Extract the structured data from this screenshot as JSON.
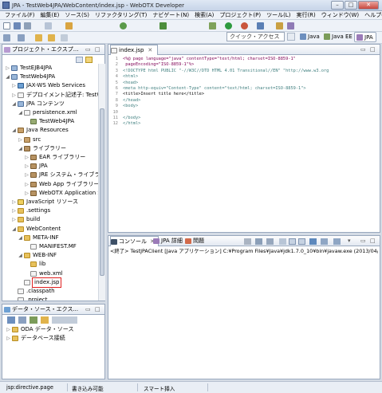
{
  "window": {
    "title": "JPA - TestWeb4JPA/WebContent/index.jsp - WebOTX Developer",
    "min": "–",
    "max": "□",
    "close": "✕"
  },
  "menu": [
    "ファイル(F)",
    "編集(E)",
    "ソース(S)",
    "リファクタリング(T)",
    "ナビゲート(N)",
    "検索(A)",
    "プロジェクト(P)",
    "ツール(L)",
    "実行(R)",
    "ウィンドウ(W)",
    "ヘルプ(H)"
  ],
  "toolbar": {
    "quick_access_placeholder": "クイック・アクセス",
    "perspectives": [
      {
        "label": "Java",
        "color": "#6d8fbe"
      },
      {
        "label": "Java EE",
        "color": "#7b9c5a"
      },
      {
        "label": "JPA",
        "color": "#9b7bb8"
      }
    ]
  },
  "project_explorer": {
    "title": "プロジェクト・エクスプ...",
    "items": [
      {
        "label": "TestEJB4JPA",
        "icon": "project-icon",
        "depth": 0,
        "tw": "▷"
      },
      {
        "label": "TestWeb4JPA",
        "icon": "project-icon",
        "depth": 0,
        "tw": "◢"
      },
      {
        "label": "JAX-WS Web Services",
        "icon": "webservice-icon",
        "depth": 1,
        "tw": "▷"
      },
      {
        "label": "デプロイメント記述子: TestW",
        "icon": "descriptor-icon",
        "depth": 1,
        "tw": "▷"
      },
      {
        "label": "JPA コンテンツ",
        "icon": "jpa-icon",
        "depth": 1,
        "tw": "◢"
      },
      {
        "label": "persistence.xml",
        "icon": "xml-file-icon",
        "depth": 2,
        "tw": "◢"
      },
      {
        "label": "TestWeb4JPA",
        "icon": "persistence-unit-icon",
        "depth": 3,
        "tw": ""
      },
      {
        "label": "Java Resources",
        "icon": "java-resources-icon",
        "depth": 1,
        "tw": "◢"
      },
      {
        "label": "src",
        "icon": "source-folder-icon",
        "depth": 2,
        "tw": "▷"
      },
      {
        "label": "ライブラリー",
        "icon": "library-icon",
        "depth": 2,
        "tw": "◢"
      },
      {
        "label": "EAR ライブラリー",
        "icon": "library-icon",
        "depth": 3,
        "tw": "▷"
      },
      {
        "label": "JPA",
        "icon": "library-icon",
        "depth": 3,
        "tw": "▷"
      },
      {
        "label": "JRE システム・ライブラ",
        "icon": "library-icon",
        "depth": 3,
        "tw": "▷"
      },
      {
        "label": "Web App ライブラリー",
        "icon": "library-icon",
        "depth": 3,
        "tw": "▷"
      },
      {
        "label": "WebOTX Application S",
        "icon": "library-icon",
        "depth": 3,
        "tw": "▷"
      },
      {
        "label": "JavaScript リソース",
        "icon": "javascript-icon",
        "depth": 1,
        "tw": "▷"
      },
      {
        "label": ".settings",
        "icon": "folder-icon",
        "depth": 1,
        "tw": "▷"
      },
      {
        "label": "build",
        "icon": "folder-icon",
        "depth": 1,
        "tw": "▷"
      },
      {
        "label": "WebContent",
        "icon": "folder-icon",
        "depth": 1,
        "tw": "◢"
      },
      {
        "label": "META-INF",
        "icon": "folder-icon",
        "depth": 2,
        "tw": "◢"
      },
      {
        "label": "MANIFEST.MF",
        "icon": "file-icon",
        "depth": 3,
        "tw": ""
      },
      {
        "label": "WEB-INF",
        "icon": "folder-icon",
        "depth": 2,
        "tw": "◢"
      },
      {
        "label": "lib",
        "icon": "folder-icon",
        "depth": 3,
        "tw": ""
      },
      {
        "label": "web.xml",
        "icon": "xml-file-icon",
        "depth": 3,
        "tw": ""
      },
      {
        "label": "index.jsp",
        "icon": "jsp-file-icon",
        "depth": 2,
        "tw": "",
        "selected": true
      },
      {
        "label": ".classpath",
        "icon": "file-icon",
        "depth": 1,
        "tw": ""
      },
      {
        "label": ".project",
        "icon": "file-icon",
        "depth": 1,
        "tw": ""
      }
    ]
  },
  "data_source": {
    "title": "データ・ソース・エクス...",
    "items": [
      {
        "label": "ODA データ・ソース",
        "tw": "▷"
      },
      {
        "label": "データベース接続",
        "tw": "▷"
      }
    ]
  },
  "editor": {
    "tab": "index.jsp",
    "lines": [
      {
        "n": "1",
        "text": "<%@ page language=\"java\" contentType=\"text/html; charset=ISO-8859-1\""
      },
      {
        "n": "2",
        "text": "    pageEncoding=\"ISO-8859-1\"%>"
      },
      {
        "n": "3",
        "text": "<!DOCTYPE html PUBLIC \"-//W3C//DTD HTML 4.01 Transitional//EN\" \"http://www.w3.org"
      },
      {
        "n": "4",
        "text": "<html>"
      },
      {
        "n": "5",
        "text": "<head>"
      },
      {
        "n": "6",
        "text": "<meta http-equiv=\"Content-Type\" content=\"text/html; charset=ISO-8859-1\">"
      },
      {
        "n": "7",
        "text": "<title>Insert title here</title>"
      },
      {
        "n": "8",
        "text": "</head>"
      },
      {
        "n": "9",
        "text": "<body>"
      },
      {
        "n": "10",
        "text": ""
      },
      {
        "n": "11",
        "text": "</body>"
      },
      {
        "n": "12",
        "text": "</html>"
      }
    ]
  },
  "console": {
    "tabs": [
      "コンソール",
      "JPA 詳細",
      "問題"
    ],
    "text": "<終了> TestJPAClient [Java アプリケーション] C:¥Program Files¥Java¥jdk1.7.0_10¥bin¥javaw.exe (2013/04/1"
  },
  "status": {
    "left": "jsp:directive.page",
    "mid": "書き込み可能",
    "right": "スマート挿入"
  }
}
